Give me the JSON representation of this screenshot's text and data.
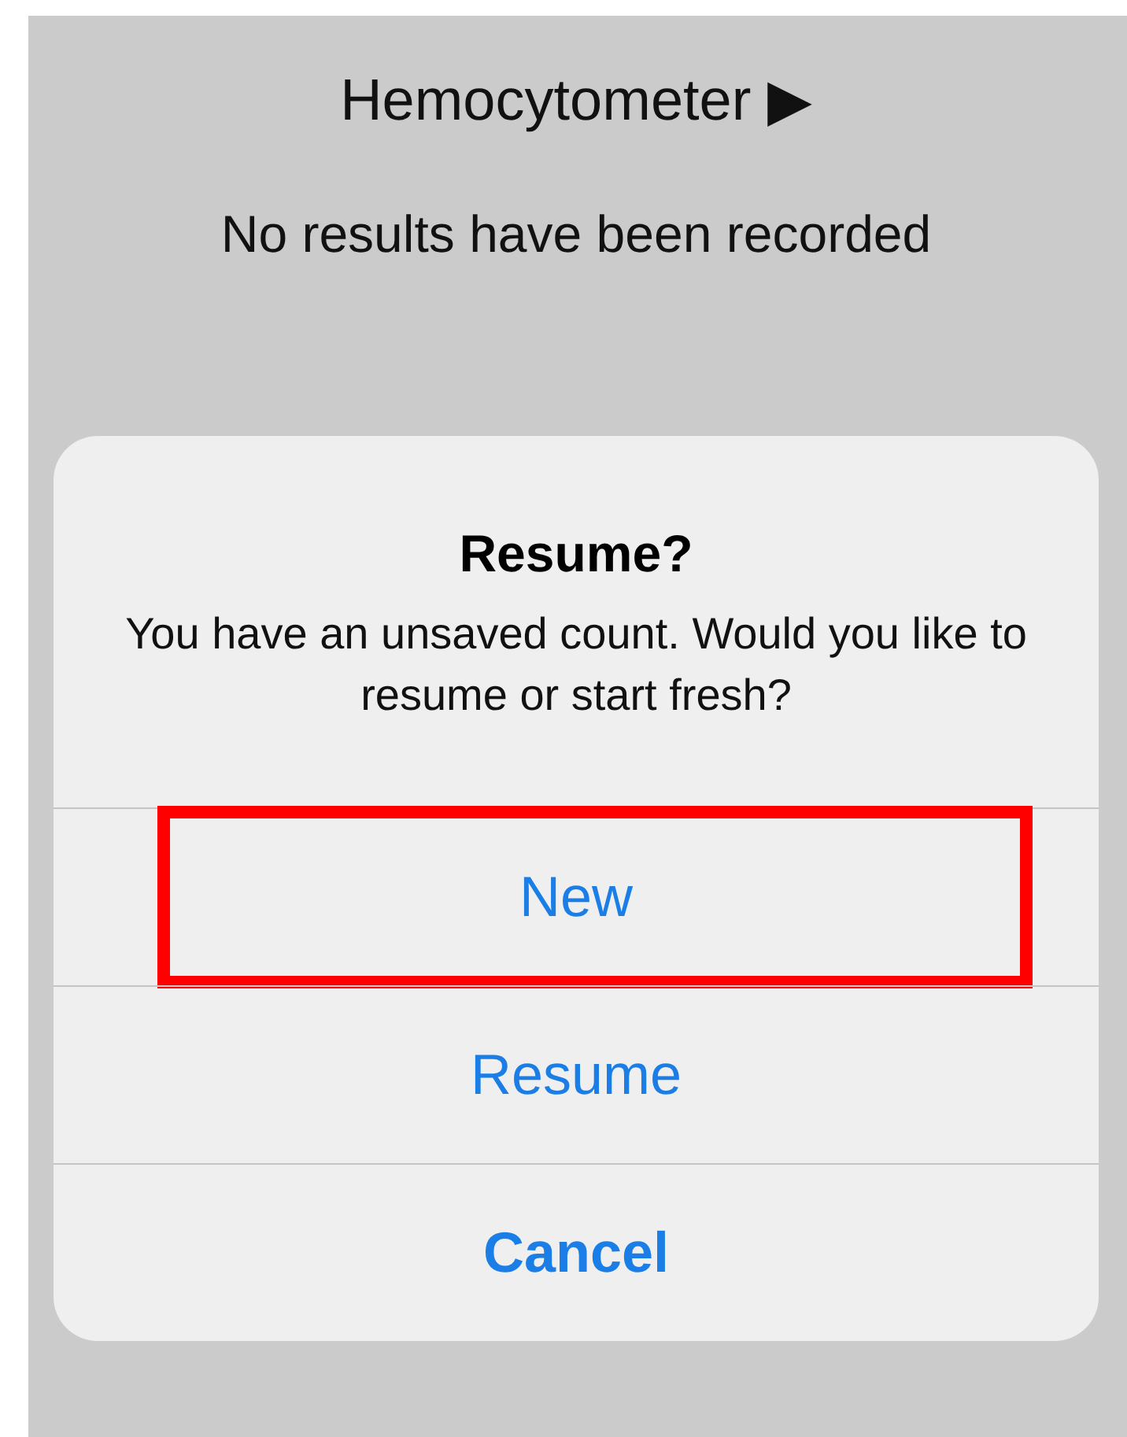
{
  "header": {
    "title": "Hemocytometer ▶",
    "subtitle": "No results have been recorded"
  },
  "alert": {
    "title": "Resume?",
    "message": "You have an unsaved count. Would you like to resume or start fresh?",
    "buttons": [
      {
        "label": "New",
        "kind": "default",
        "highlighted": true
      },
      {
        "label": "Resume",
        "kind": "default",
        "highlighted": false
      },
      {
        "label": "Cancel",
        "kind": "cancel",
        "highlighted": false
      }
    ]
  }
}
